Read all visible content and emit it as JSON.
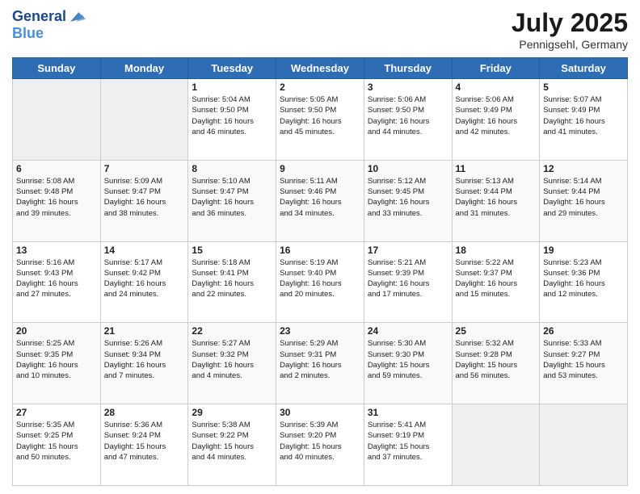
{
  "header": {
    "logo_line1": "General",
    "logo_line2": "Blue",
    "month_year": "July 2025",
    "location": "Pennigsehl, Germany"
  },
  "weekdays": [
    "Sunday",
    "Monday",
    "Tuesday",
    "Wednesday",
    "Thursday",
    "Friday",
    "Saturday"
  ],
  "weeks": [
    [
      {
        "day": "",
        "info": ""
      },
      {
        "day": "",
        "info": ""
      },
      {
        "day": "1",
        "info": "Sunrise: 5:04 AM\nSunset: 9:50 PM\nDaylight: 16 hours\nand 46 minutes."
      },
      {
        "day": "2",
        "info": "Sunrise: 5:05 AM\nSunset: 9:50 PM\nDaylight: 16 hours\nand 45 minutes."
      },
      {
        "day": "3",
        "info": "Sunrise: 5:06 AM\nSunset: 9:50 PM\nDaylight: 16 hours\nand 44 minutes."
      },
      {
        "day": "4",
        "info": "Sunrise: 5:06 AM\nSunset: 9:49 PM\nDaylight: 16 hours\nand 42 minutes."
      },
      {
        "day": "5",
        "info": "Sunrise: 5:07 AM\nSunset: 9:49 PM\nDaylight: 16 hours\nand 41 minutes."
      }
    ],
    [
      {
        "day": "6",
        "info": "Sunrise: 5:08 AM\nSunset: 9:48 PM\nDaylight: 16 hours\nand 39 minutes."
      },
      {
        "day": "7",
        "info": "Sunrise: 5:09 AM\nSunset: 9:47 PM\nDaylight: 16 hours\nand 38 minutes."
      },
      {
        "day": "8",
        "info": "Sunrise: 5:10 AM\nSunset: 9:47 PM\nDaylight: 16 hours\nand 36 minutes."
      },
      {
        "day": "9",
        "info": "Sunrise: 5:11 AM\nSunset: 9:46 PM\nDaylight: 16 hours\nand 34 minutes."
      },
      {
        "day": "10",
        "info": "Sunrise: 5:12 AM\nSunset: 9:45 PM\nDaylight: 16 hours\nand 33 minutes."
      },
      {
        "day": "11",
        "info": "Sunrise: 5:13 AM\nSunset: 9:44 PM\nDaylight: 16 hours\nand 31 minutes."
      },
      {
        "day": "12",
        "info": "Sunrise: 5:14 AM\nSunset: 9:44 PM\nDaylight: 16 hours\nand 29 minutes."
      }
    ],
    [
      {
        "day": "13",
        "info": "Sunrise: 5:16 AM\nSunset: 9:43 PM\nDaylight: 16 hours\nand 27 minutes."
      },
      {
        "day": "14",
        "info": "Sunrise: 5:17 AM\nSunset: 9:42 PM\nDaylight: 16 hours\nand 24 minutes."
      },
      {
        "day": "15",
        "info": "Sunrise: 5:18 AM\nSunset: 9:41 PM\nDaylight: 16 hours\nand 22 minutes."
      },
      {
        "day": "16",
        "info": "Sunrise: 5:19 AM\nSunset: 9:40 PM\nDaylight: 16 hours\nand 20 minutes."
      },
      {
        "day": "17",
        "info": "Sunrise: 5:21 AM\nSunset: 9:39 PM\nDaylight: 16 hours\nand 17 minutes."
      },
      {
        "day": "18",
        "info": "Sunrise: 5:22 AM\nSunset: 9:37 PM\nDaylight: 16 hours\nand 15 minutes."
      },
      {
        "day": "19",
        "info": "Sunrise: 5:23 AM\nSunset: 9:36 PM\nDaylight: 16 hours\nand 12 minutes."
      }
    ],
    [
      {
        "day": "20",
        "info": "Sunrise: 5:25 AM\nSunset: 9:35 PM\nDaylight: 16 hours\nand 10 minutes."
      },
      {
        "day": "21",
        "info": "Sunrise: 5:26 AM\nSunset: 9:34 PM\nDaylight: 16 hours\nand 7 minutes."
      },
      {
        "day": "22",
        "info": "Sunrise: 5:27 AM\nSunset: 9:32 PM\nDaylight: 16 hours\nand 4 minutes."
      },
      {
        "day": "23",
        "info": "Sunrise: 5:29 AM\nSunset: 9:31 PM\nDaylight: 16 hours\nand 2 minutes."
      },
      {
        "day": "24",
        "info": "Sunrise: 5:30 AM\nSunset: 9:30 PM\nDaylight: 15 hours\nand 59 minutes."
      },
      {
        "day": "25",
        "info": "Sunrise: 5:32 AM\nSunset: 9:28 PM\nDaylight: 15 hours\nand 56 minutes."
      },
      {
        "day": "26",
        "info": "Sunrise: 5:33 AM\nSunset: 9:27 PM\nDaylight: 15 hours\nand 53 minutes."
      }
    ],
    [
      {
        "day": "27",
        "info": "Sunrise: 5:35 AM\nSunset: 9:25 PM\nDaylight: 15 hours\nand 50 minutes."
      },
      {
        "day": "28",
        "info": "Sunrise: 5:36 AM\nSunset: 9:24 PM\nDaylight: 15 hours\nand 47 minutes."
      },
      {
        "day": "29",
        "info": "Sunrise: 5:38 AM\nSunset: 9:22 PM\nDaylight: 15 hours\nand 44 minutes."
      },
      {
        "day": "30",
        "info": "Sunrise: 5:39 AM\nSunset: 9:20 PM\nDaylight: 15 hours\nand 40 minutes."
      },
      {
        "day": "31",
        "info": "Sunrise: 5:41 AM\nSunset: 9:19 PM\nDaylight: 15 hours\nand 37 minutes."
      },
      {
        "day": "",
        "info": ""
      },
      {
        "day": "",
        "info": ""
      }
    ]
  ]
}
